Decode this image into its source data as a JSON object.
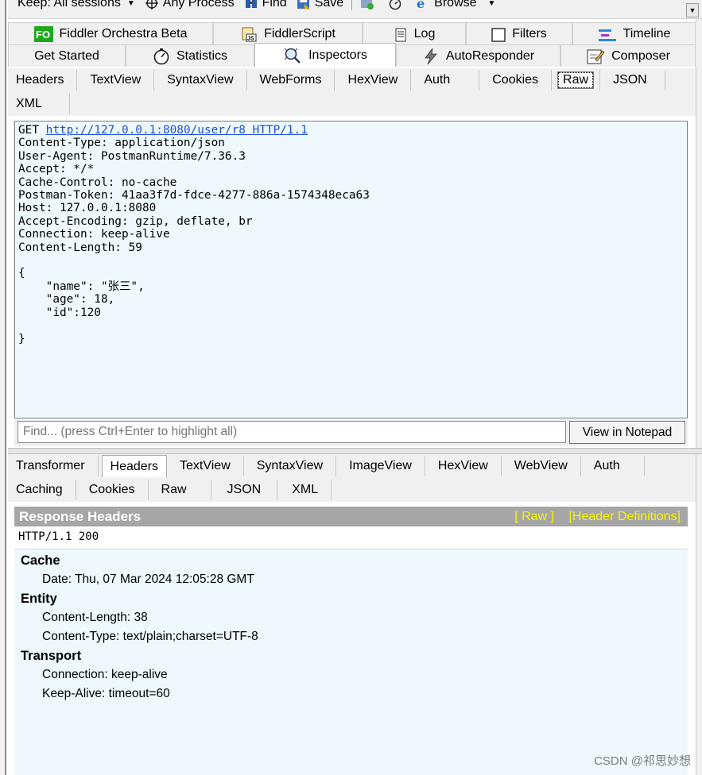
{
  "toolbar": {
    "keep_label": "Keep: All sessions",
    "process_label": "Any Process",
    "find_label": "Find",
    "save_label": "Save",
    "browse_label": "Browse"
  },
  "main_tabs": {
    "row1": [
      {
        "label": "Fiddler Orchestra Beta",
        "icon": "fo-icon"
      },
      {
        "label": "FiddlerScript",
        "icon": "script-icon"
      },
      {
        "label": "Log",
        "icon": "log-icon"
      },
      {
        "label": "Filters",
        "icon": "checkbox-icon"
      },
      {
        "label": "Timeline",
        "icon": "timeline-icon"
      }
    ],
    "row2": [
      {
        "label": "Get Started",
        "icon": ""
      },
      {
        "label": "Statistics",
        "icon": "stopwatch-icon"
      },
      {
        "label": "Inspectors",
        "icon": "magnifier-icon"
      },
      {
        "label": "AutoResponder",
        "icon": "lightning-icon"
      },
      {
        "label": "Composer",
        "icon": "compose-icon"
      }
    ]
  },
  "request_tabs": {
    "row1": [
      "Headers",
      "TextView",
      "SyntaxView",
      "WebForms",
      "HexView",
      "Auth",
      "Cookies",
      "Raw",
      "JSON"
    ],
    "row2": [
      "XML"
    ],
    "selected": "Raw"
  },
  "request": {
    "method": "GET",
    "url": "http://127.0.0.1:8080/user/r8",
    "protocol": "HTTP/1.1",
    "headers": [
      "Content-Type: application/json",
      "User-Agent: PostmanRuntime/7.36.3",
      "Accept: */*",
      "Cache-Control: no-cache",
      "Postman-Token: 41aa3f7d-fdce-4277-886a-1574348eca63",
      "Host: 127.0.0.1:8080",
      "Accept-Encoding: gzip, deflate, br",
      "Connection: keep-alive",
      "Content-Length: 59"
    ],
    "body": "{\n    \"name\": \"张三\",\n    \"age\": 18,\n    \"id\":120\n\n}"
  },
  "find": {
    "placeholder": "Find... (press Ctrl+Enter to highlight all)",
    "button_label": "View in Notepad"
  },
  "response_tabs": {
    "row1": [
      "Transformer",
      "Headers",
      "TextView",
      "SyntaxView",
      "ImageView",
      "HexView",
      "WebView",
      "Auth"
    ],
    "row2": [
      "Caching",
      "Cookies",
      "Raw",
      "JSON",
      "XML"
    ],
    "selected": "Headers"
  },
  "response": {
    "title": "Response Headers",
    "raw_link": "[ Raw ]",
    "defs_link": "[Header Definitions]",
    "status": "HTTP/1.1 200",
    "groups": [
      {
        "name": "Cache",
        "headers": [
          "Date: Thu, 07 Mar 2024 12:05:28 GMT"
        ]
      },
      {
        "name": "Entity",
        "headers": [
          "Content-Length: 38",
          "Content-Type: text/plain;charset=UTF-8"
        ]
      },
      {
        "name": "Transport",
        "headers": [
          "Connection: keep-alive",
          "Keep-Alive: timeout=60"
        ]
      }
    ]
  },
  "watermark": "CSDN @祁思妙想"
}
